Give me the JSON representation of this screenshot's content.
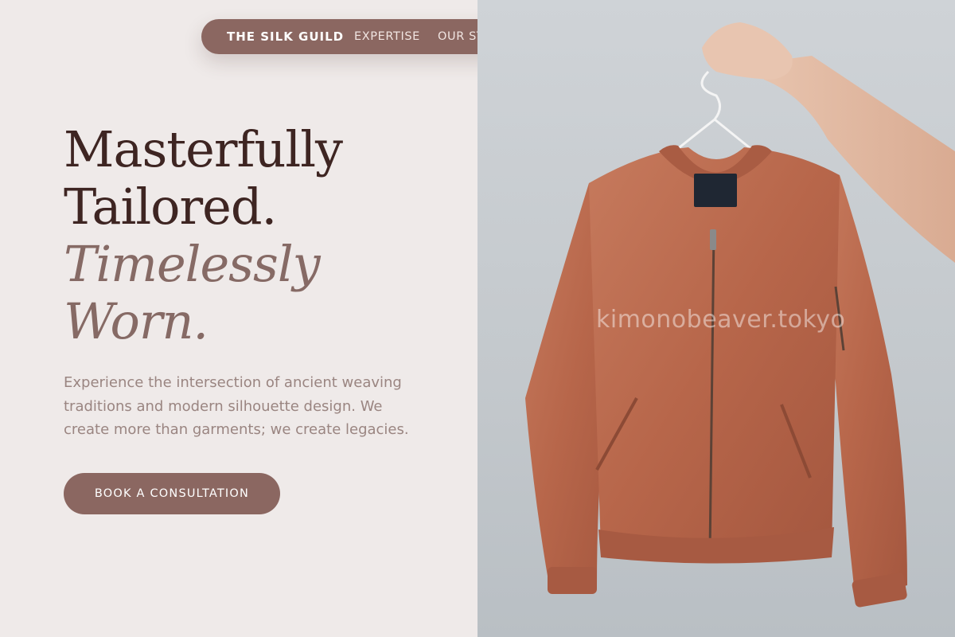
{
  "nav": {
    "brand": "THE SILK GUILD",
    "links": [
      "EXPERTISE",
      "OUR ST"
    ]
  },
  "hero": {
    "headline": [
      "Masterfully",
      "Tailored.",
      "Timelessly",
      "Worn."
    ],
    "lead": "Experience the intersection of ancient weaving traditions and modern silhouette design. We create more than garments; we create legacies.",
    "cta_label": "BOOK A CONSULTATION"
  },
  "image": {
    "subject": "rust bomber jacket on hanger held by hand",
    "watermark": "kimonobeaver.tokyo"
  },
  "colors": {
    "accent": "#8b6761",
    "page_bg": "#efeae9",
    "heading": "#3e2522",
    "heading_italic": "#866a65",
    "body_text": "#9a8581",
    "jacket": "#b9674b"
  }
}
